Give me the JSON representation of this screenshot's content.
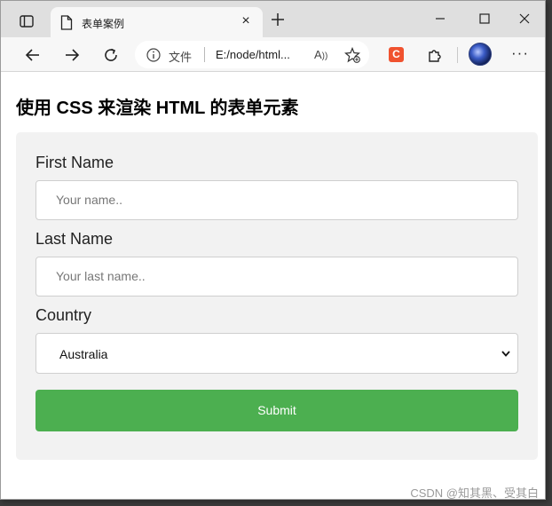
{
  "browser": {
    "tab_title": "表单案例",
    "tab_close": "×",
    "address_label": "文件",
    "address_url": "E:/node/html...",
    "read_aloud": "A",
    "extension_letter": "C",
    "more_menu": "···"
  },
  "page": {
    "heading": "使用 CSS 来渲染 HTML 的表单元素",
    "form": {
      "first_name_label": "First Name",
      "first_name_placeholder": "Your name..",
      "last_name_label": "Last Name",
      "last_name_placeholder": "Your last name..",
      "country_label": "Country",
      "country_selected": "Australia",
      "submit_label": "Submit"
    }
  },
  "watermark": "CSDN @知其黑、受其白",
  "colors": {
    "submit_bg": "#4caf50",
    "form_bg": "#f2f2f2",
    "extension_accent": "#f0522f"
  }
}
